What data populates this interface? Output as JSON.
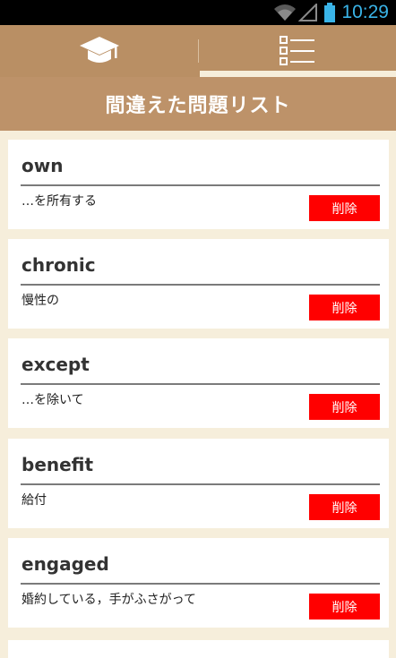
{
  "status_bar": {
    "time": "10:29",
    "icons": [
      "wifi-icon",
      "signal-icon",
      "battery-icon"
    ]
  },
  "tabs": [
    {
      "name": "learn",
      "icon": "graduation-cap-icon",
      "selected": false
    },
    {
      "name": "list",
      "icon": "checklist-icon",
      "selected": true
    }
  ],
  "header": {
    "title": "間違えた問題リスト"
  },
  "items": [
    {
      "word": "own",
      "meaning": "…を所有する",
      "delete_label": "削除"
    },
    {
      "word": "chronic",
      "meaning": "慢性の",
      "delete_label": "削除"
    },
    {
      "word": "except",
      "meaning": "…を除いて",
      "delete_label": "削除"
    },
    {
      "word": "benefit",
      "meaning": "給付",
      "delete_label": "削除"
    },
    {
      "word": "engaged",
      "meaning": "婚約している，手がふさがって",
      "delete_label": "削除"
    }
  ],
  "colors": {
    "tab_bar": "#b98f64",
    "title_bar": "#bd9269",
    "background": "#f6eedb",
    "delete_button": "#ff0000",
    "status_icons": "#3ab4e8"
  }
}
